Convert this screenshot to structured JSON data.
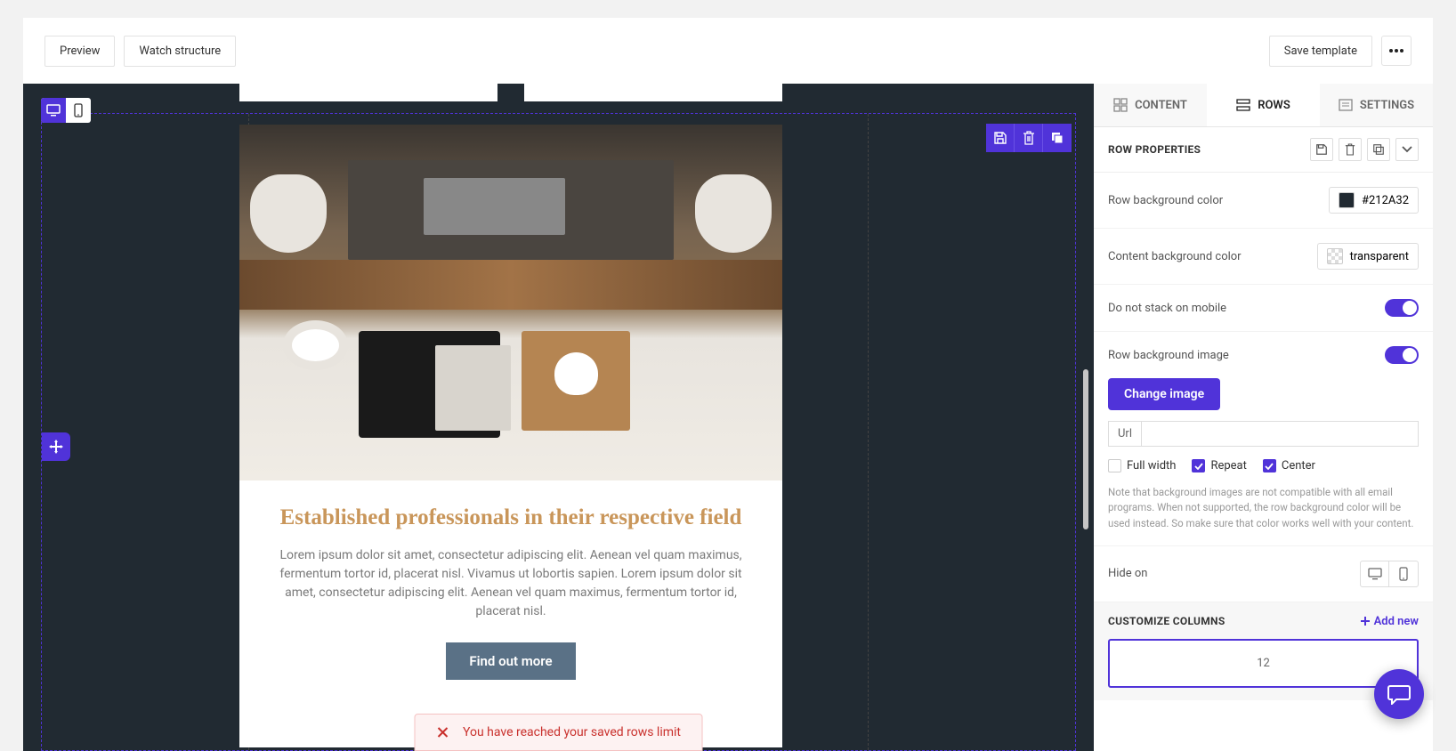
{
  "topbar": {
    "preview": "Preview",
    "watch": "Watch structure",
    "save": "Save template"
  },
  "tabs": {
    "content": "CONTENT",
    "rows": "ROWS",
    "settings": "SETTINGS"
  },
  "section": {
    "title": "ROW PROPERTIES",
    "bgcolor_label": "Row background color",
    "bgcolor_value": "#212A32",
    "contentbg_label": "Content background color",
    "contentbg_value": "transparent",
    "nostack_label": "Do not stack on mobile",
    "bgimage_label": "Row background image",
    "change_image": "Change image",
    "url_label": "Url",
    "fullwidth": "Full width",
    "repeat": "Repeat",
    "center": "Center",
    "note": "Note that background images are not compatible with all email programs. When not supported, the row background color will be used instead. So make sure that color works well with your content.",
    "hideon_label": "Hide on"
  },
  "columns": {
    "title": "CUSTOMIZE COLUMNS",
    "add": "Add new",
    "value": "12"
  },
  "content": {
    "title": "Established professionals in their respective field",
    "body": "Lorem ipsum dolor sit amet, consectetur adipiscing elit. Aenean vel quam maximus, fermentum tortor id, placerat nisl. Vivamus ut lobortis sapien. Lorem ipsum dolor sit amet, consectetur adipiscing elit. Aenean vel quam maximus, fermentum tortor id, placerat nisl.",
    "cta": "Find out more"
  },
  "alert": {
    "msg": "You have reached your saved rows limit"
  }
}
